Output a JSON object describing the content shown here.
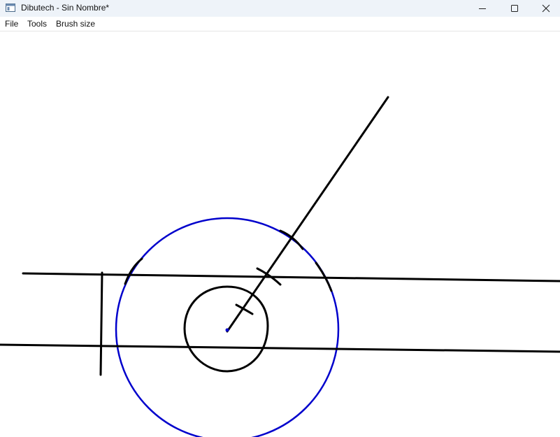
{
  "window": {
    "title": "Dibutech - Sin Nombre*",
    "app_icon": "app-window-icon",
    "controls": [
      "minimize-icon",
      "maximize-icon",
      "close-icon"
    ]
  },
  "menu": {
    "items": [
      {
        "label": "File"
      },
      {
        "label": "Tools"
      },
      {
        "label": "Brush size"
      }
    ]
  },
  "canvas": {
    "background": "#ffffff",
    "stroke_colors": {
      "black": "#000000",
      "blue": "#0000cc"
    }
  }
}
